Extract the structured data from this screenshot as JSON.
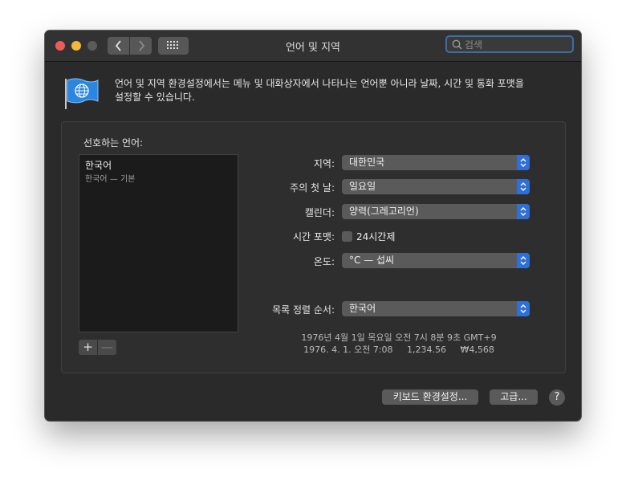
{
  "window": {
    "title": "언어 및 지역",
    "search": {
      "placeholder": "검색",
      "value": ""
    }
  },
  "header": {
    "description_line1": "언어 및 지역 환경설정에서는 메뉴 및 대화상자에서 나타나는 언어뿐 아니라 날짜, 시간 및 통화 포맷을",
    "description_line2": "설정할 수 있습니다."
  },
  "languages": {
    "label": "선호하는 언어:",
    "items": [
      {
        "name": "한국어",
        "detail": "한국어 — 기본"
      }
    ],
    "add_label": "+",
    "remove_label": "—"
  },
  "settings": {
    "region": {
      "label": "지역:",
      "value": "대한민국"
    },
    "first_day": {
      "label": "주의 첫 날:",
      "value": "일요일"
    },
    "calendar": {
      "label": "캘린더:",
      "value": "양력(그레고리언)"
    },
    "time_format": {
      "label": "시간 포맷:",
      "checkbox_label": "24시간제",
      "checked": false
    },
    "temperature": {
      "label": "온도:",
      "value": "°C — 섭씨"
    },
    "sort_order": {
      "label": "목록 정렬 순서:",
      "value": "한국어"
    }
  },
  "sample": {
    "line1": "1976년 4월 1일 목요일 오전 7시 8분 9초 GMT+9",
    "line2": "1976. 4. 1. 오전 7:08     1,234.56     ₩4,568"
  },
  "footer": {
    "keyboard_button": "키보드 환경설정...",
    "advanced_button": "고급...",
    "help_label": "?"
  },
  "colors": {
    "accent": "#2f6fd8",
    "window_bg": "#2a2a2a",
    "close": "#ee5b57",
    "minimize": "#f3b73a"
  }
}
